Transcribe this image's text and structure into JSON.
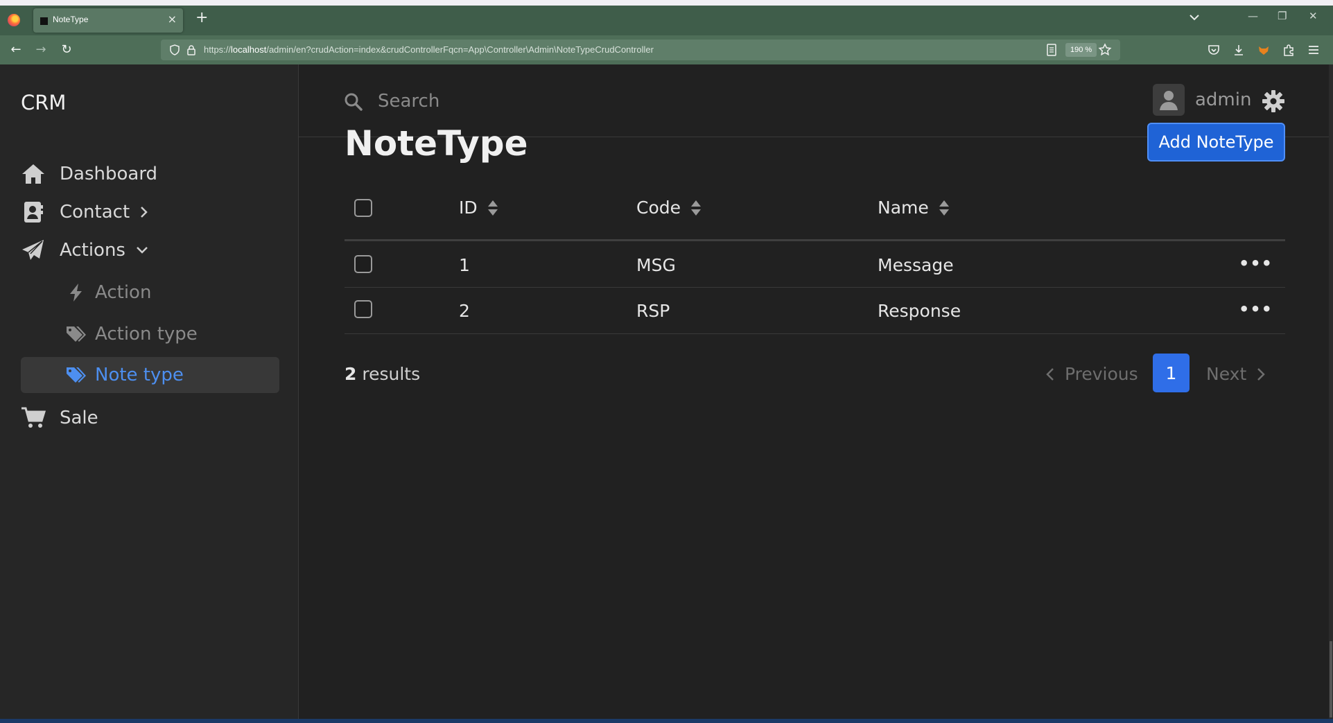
{
  "browser": {
    "tab_title": "NoteType",
    "tab_close": "×",
    "new_tab": "+",
    "url_prefix": "https://",
    "url_host": "localhost",
    "url_path": "/admin/en?crudAction=index&crudControllerFqcn=App\\Controller\\Admin\\NoteTypeCrudController",
    "zoom": "190 %"
  },
  "sidebar": {
    "brand": "CRM",
    "items": [
      {
        "label": "Dashboard",
        "icon": "home-icon"
      },
      {
        "label": "Contact",
        "icon": "contact-card-icon",
        "arrow": "›"
      },
      {
        "label": "Actions",
        "icon": "paper-plane-icon",
        "arrow": "⌄"
      },
      {
        "label": "Sale",
        "icon": "cart-icon"
      }
    ],
    "subitems": [
      {
        "label": "Action",
        "icon": "bolt-icon"
      },
      {
        "label": "Action type",
        "icon": "tags-icon"
      },
      {
        "label": "Note type",
        "icon": "tags-icon",
        "active": true
      }
    ]
  },
  "topbar": {
    "search_placeholder": "Search",
    "username": "admin"
  },
  "main": {
    "title": "NoteType",
    "add_button": "Add NoteType",
    "columns": [
      "ID",
      "Code",
      "Name"
    ],
    "rows": [
      {
        "id": "1",
        "code": "MSG",
        "name": "Message",
        "actions": "•••"
      },
      {
        "id": "2",
        "code": "RSP",
        "name": "Response",
        "actions": "•••"
      }
    ],
    "results_count": "2",
    "results_label": "results",
    "pagination": {
      "previous": "Previous",
      "current": "1",
      "next": "Next"
    }
  },
  "colors": {
    "accent": "#1f63d6",
    "active_link": "#4d8ff0",
    "background": "#212121",
    "sidebar": "#262626",
    "browser_chrome": "#4e6e58"
  }
}
